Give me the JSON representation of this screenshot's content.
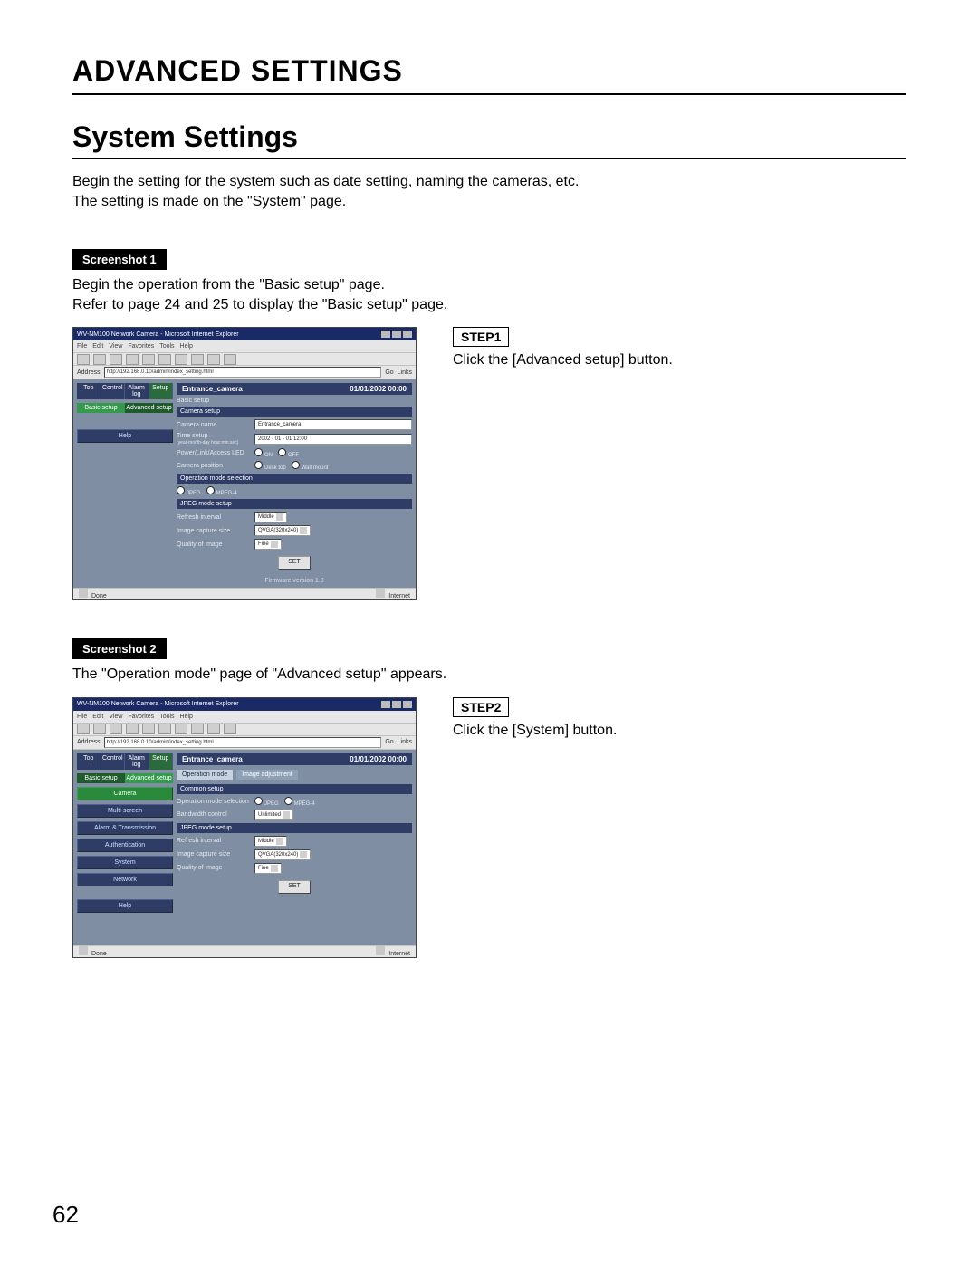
{
  "page": {
    "title": "ADVANCED SETTINGS",
    "subtitle": "System Settings",
    "intro_line1": "Begin the setting for the system such as date setting, naming the cameras, etc.",
    "intro_line2": "The setting is made on the \"System\" page.",
    "page_number": "62"
  },
  "s1": {
    "label": "Screenshot 1",
    "desc_line1": "Begin the operation from the \"Basic setup\" page.",
    "desc_line2": "Refer to page 24 and 25 to display the \"Basic setup\" page.",
    "step_label": "STEP1",
    "step_text": "Click the [Advanced setup] button.",
    "browser_title": "WV-NM100 Network Camera - Microsoft Internet Explorer",
    "menu": {
      "file": "File",
      "edit": "Edit",
      "view": "View",
      "favorites": "Favorites",
      "tools": "Tools",
      "help": "Help"
    },
    "address_label": "Address",
    "address_url": "http://192.168.0.10/admin/index_setting.html",
    "go": "Go",
    "links": "Links",
    "tabs": {
      "top": "Top",
      "control": "Control",
      "alarm_log": "Alarm log",
      "setup": "Setup"
    },
    "setup_tabs": {
      "basic": "Basic setup",
      "advanced": "Advanced setup"
    },
    "side": {
      "help": "Help"
    },
    "hdr_camera": "Entrance_camera",
    "hdr_timestamp": "01/01/2002  00:00",
    "crumb": "Basic setup",
    "sections": {
      "camera_setup": "Camera setup",
      "camera_name_k": "Camera name",
      "camera_name_v": "Entrance_camera",
      "time_setup_k": "Time setup",
      "time_setup_hint": "(year-month-day hour:min:sec)",
      "time_setup_v": "2002 - 01 - 01  12:00",
      "led_k": "Power/Link/Access LED",
      "led_on": "ON",
      "led_off": "OFF",
      "pos_k": "Camera position",
      "pos_desktop": "Desk top",
      "pos_wall": "Wall mount",
      "opmode_sel": "Operation mode selection",
      "jpeg": "JPEG",
      "mpeg4": "MPEG-4",
      "jpeg_mode_setup": "JPEG mode setup",
      "refresh_k": "Refresh interval",
      "refresh_v": "Middle",
      "capsize_k": "Image capture size",
      "capsize_v": "QVGA(320x240)",
      "quality_k": "Quality of image",
      "quality_v": "Fine",
      "set": "SET",
      "firmware": "Firmware version  1.0"
    },
    "status_done": "Done",
    "status_internet": "Internet"
  },
  "s2": {
    "label": "Screenshot 2",
    "desc": "The \"Operation mode\" page of \"Advanced setup\" appears.",
    "step_label": "STEP2",
    "step_text": "Click the [System] button.",
    "browser_title": "WV-NM100 Network Camera - Microsoft Internet Explorer",
    "menu": {
      "file": "File",
      "edit": "Edit",
      "view": "View",
      "favorites": "Favorites",
      "tools": "Tools",
      "help": "Help"
    },
    "address_label": "Address",
    "address_url": "http://192.168.0.10/admin/index_setting.html",
    "go": "Go",
    "links": "Links",
    "tabs": {
      "top": "Top",
      "control": "Control",
      "alarm_log": "Alarm log",
      "setup": "Setup"
    },
    "setup_tabs": {
      "basic": "Basic setup",
      "advanced": "Advanced setup"
    },
    "side": {
      "camera": "Camera",
      "multiscreen": "Multi-screen",
      "alarm": "Alarm & Transmission",
      "auth": "Authentication",
      "system": "System",
      "network": "Network",
      "help": "Help"
    },
    "hdr_camera": "Entrance_camera",
    "hdr_timestamp": "01/01/2002  00:00",
    "crumb1": "Operation mode",
    "crumb2": "Image adjustment",
    "sections": {
      "common_setup": "Common setup",
      "opmode_sel_k": "Operation mode selection",
      "jpeg": "JPEG",
      "mpeg4": "MPEG-4",
      "bw_k": "Bandwidth control",
      "bw_v": "Unlimited",
      "jpeg_mode_setup": "JPEG mode setup",
      "refresh_k": "Refresh interval",
      "refresh_v": "Middle",
      "capsize_k": "Image capture size",
      "capsize_v": "QVGA(320x240)",
      "quality_k": "Quality of image",
      "quality_v": "Fine",
      "set": "SET"
    },
    "status_done": "Done",
    "status_internet": "Internet"
  }
}
